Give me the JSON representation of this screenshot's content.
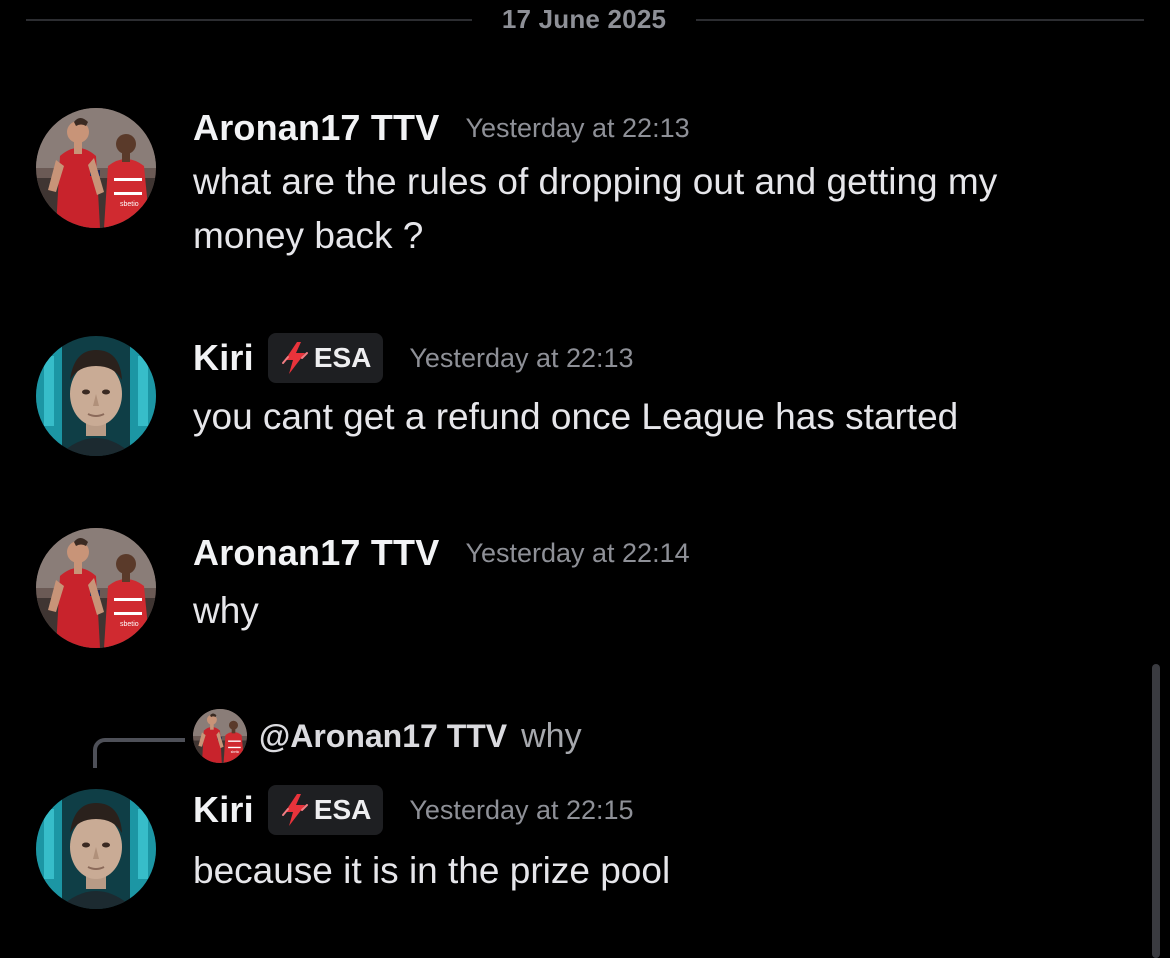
{
  "date_divider": "17 June 2025",
  "colors": {
    "background": "#000000",
    "username": "#f2f3f5",
    "timestamp": "#8e9097",
    "badge_bg": "#1e1f22",
    "bolt": "#e8333b"
  },
  "messages": [
    {
      "author": "Aronan17 TTV",
      "avatar_icon": "football-players-avatar",
      "timestamp": "Yesterday at 22:13",
      "text": "what are the rules of dropping out and getting my money back ?"
    },
    {
      "author": "Kiri",
      "avatar_icon": "man-face-avatar",
      "badge_icon": "lightning-bolt-icon",
      "badge": "ESA",
      "timestamp": "Yesterday at 22:13",
      "text": "you cant get a refund once League has started"
    },
    {
      "author": "Aronan17 TTV",
      "avatar_icon": "football-players-avatar",
      "timestamp": "Yesterday at 22:14",
      "text": "why"
    },
    {
      "reply_to": {
        "author": "@Aronan17 TTV",
        "text": "why"
      },
      "author": "Kiri",
      "avatar_icon": "man-face-avatar",
      "badge_icon": "lightning-bolt-icon",
      "badge": "ESA",
      "timestamp": "Yesterday at 22:15",
      "text": "because it is in the prize pool"
    }
  ]
}
